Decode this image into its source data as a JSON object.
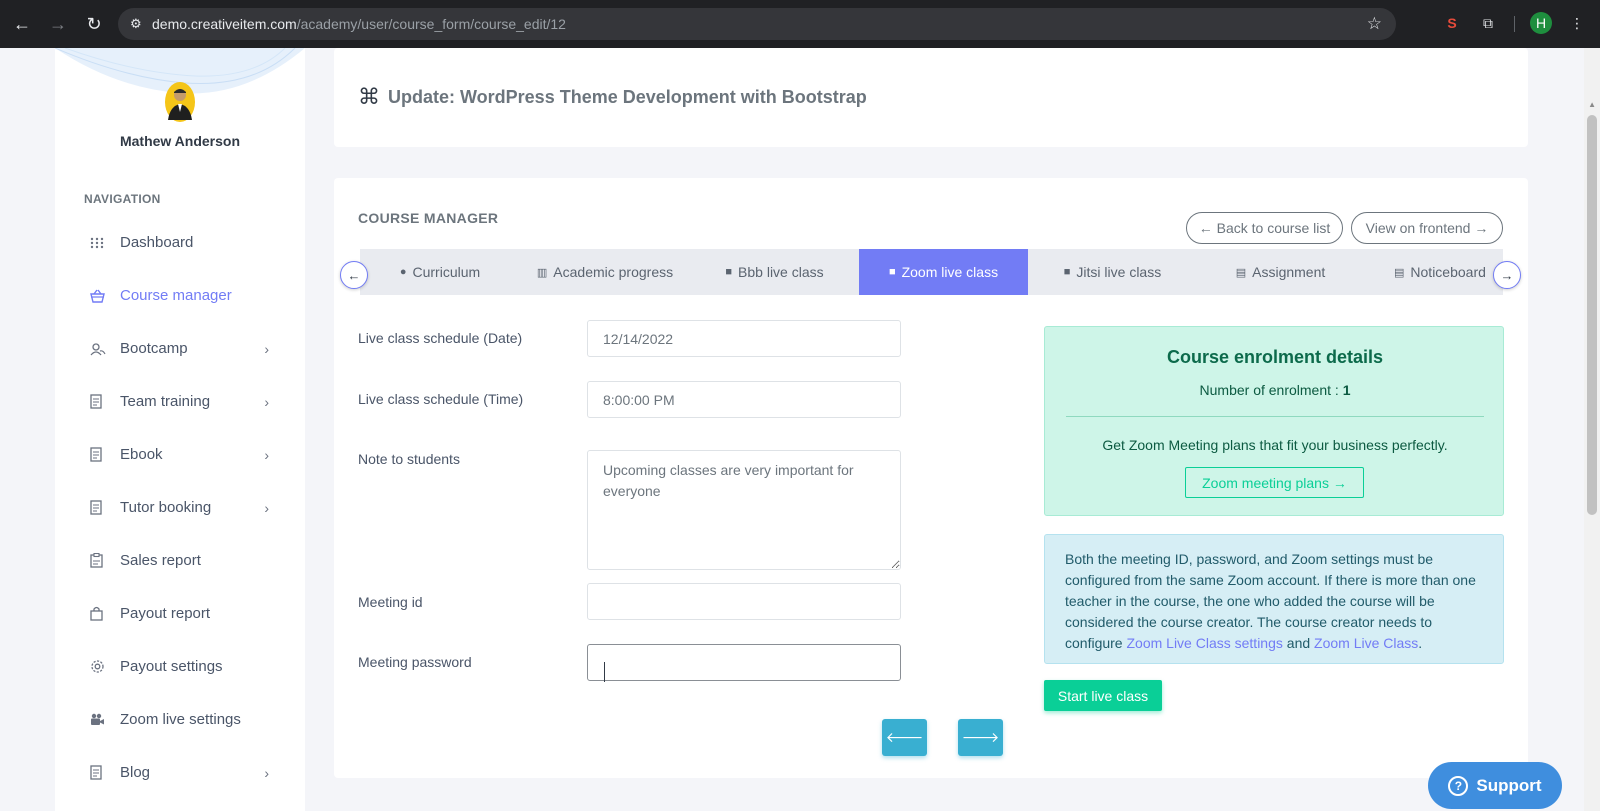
{
  "browser": {
    "url_host": "demo.creativeitem.com",
    "url_path": "/academy/user/course_form/course_edit/12",
    "avatar_letter": "H"
  },
  "sidebar": {
    "user_name": "Mathew Anderson",
    "nav_title": "NAVIGATION",
    "items": [
      {
        "label": "Dashboard",
        "icon": "grid-icon"
      },
      {
        "label": "Course manager",
        "icon": "basket-icon"
      },
      {
        "label": "Bootcamp",
        "icon": "users-icon"
      },
      {
        "label": "Team training",
        "icon": "document-icon"
      },
      {
        "label": "Ebook",
        "icon": "document-icon"
      },
      {
        "label": "Tutor booking",
        "icon": "document-icon"
      },
      {
        "label": "Sales report",
        "icon": "clipboard-icon"
      },
      {
        "label": "Payout report",
        "icon": "bag-icon"
      },
      {
        "label": "Payout settings",
        "icon": "gear-icon"
      },
      {
        "label": "Zoom live settings",
        "icon": "camera-icon"
      },
      {
        "label": "Blog",
        "icon": "document-icon"
      }
    ]
  },
  "header": {
    "title": "Update: WordPress Theme Development with Bootstrap"
  },
  "course_manager": {
    "title": "COURSE MANAGER",
    "back_label": "← Back to course list",
    "front_label": "View on frontend →",
    "tabs": [
      {
        "label": "Curriculum"
      },
      {
        "label": "Academic progress"
      },
      {
        "label": "Bbb live class"
      },
      {
        "label": "Zoom live class"
      },
      {
        "label": "Jitsi live class"
      },
      {
        "label": "Assignment"
      },
      {
        "label": "Noticeboard"
      }
    ],
    "active_tab": "Zoom live class"
  },
  "form": {
    "date_label": "Live class schedule (Date)",
    "date_value": "12/14/2022",
    "time_label": "Live class schedule (Time)",
    "time_value": "8:00:00 PM",
    "note_label": "Note to students",
    "note_value": "Upcoming classes are very important for everyone",
    "meeting_id_label": "Meeting id",
    "meeting_id_value": "",
    "meeting_password_label": "Meeting password",
    "meeting_password_value": ""
  },
  "enrolment": {
    "title": "Course enrolment details",
    "count_label": "Number of enrolment : ",
    "count_value": "1",
    "plans_text": "Get Zoom Meeting plans that fit your business perfectly.",
    "plans_button": "Zoom meeting plans →"
  },
  "info": {
    "text_1": "Both the meeting ID, password, and Zoom settings must be configured from the same Zoom account. If there is more than one teacher in the course, the one who added the course will be considered the course creator. The course creator needs to configure ",
    "link_1": "Zoom Live Class settings",
    "text_2": " and ",
    "link_2": "Zoom Live Class",
    "text_3": "."
  },
  "start_button": "Start live class",
  "support_label": "Support",
  "colors": {
    "accent": "#727cf5",
    "success": "#0acf97",
    "info": "#39afd1",
    "support": "#3f8ede"
  }
}
